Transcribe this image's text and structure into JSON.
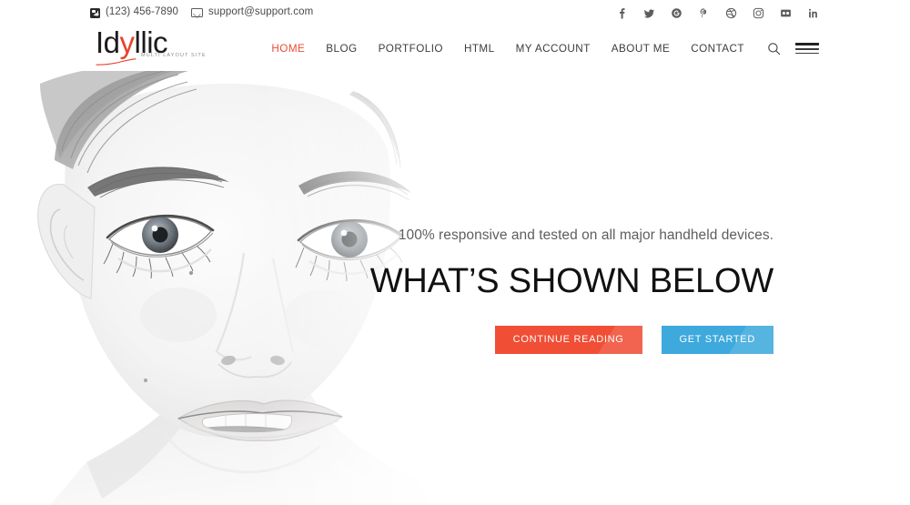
{
  "topbar": {
    "phone": "(123) 456-7890",
    "email": "support@support.com",
    "phone_icon": "phone-icon",
    "email_icon": "envelope-icon",
    "social": [
      {
        "name": "facebook",
        "label": "f"
      },
      {
        "name": "twitter",
        "label": "t"
      },
      {
        "name": "google-plus",
        "label": "g+"
      },
      {
        "name": "pinterest",
        "label": "p"
      },
      {
        "name": "dribbble",
        "label": "d"
      },
      {
        "name": "instagram",
        "label": "ig"
      },
      {
        "name": "flickr",
        "label": "fl"
      },
      {
        "name": "linkedin",
        "label": "in"
      }
    ]
  },
  "header": {
    "logo": {
      "text_before": "Id",
      "text_accent": "y",
      "text_after": "llic",
      "tagline": "Multi Layout Site",
      "accent_color": "#e8412a"
    },
    "nav": [
      {
        "label": "HOME",
        "active": true
      },
      {
        "label": "BLOG",
        "active": false
      },
      {
        "label": "PORTFOLIO",
        "active": false
      },
      {
        "label": "HTML",
        "active": false
      },
      {
        "label": "MY ACCOUNT",
        "active": false
      },
      {
        "label": "ABOUT ME",
        "active": false
      },
      {
        "label": "CONTACT",
        "active": false
      }
    ],
    "active_color": "#ef4b34",
    "search_icon": "search-icon",
    "menu_icon": "hamburger-menu-icon"
  },
  "hero": {
    "subtitle": "100% responsive and tested on all major handheld devices.",
    "title": "WHAT’S SHOWN BELOW",
    "primary_button": "CONTINUE READING",
    "secondary_button": "GET STARTED",
    "primary_color": "#f04e35",
    "secondary_color": "#3da9dc",
    "image_alt": "grayscale close-up portrait of a woman"
  }
}
